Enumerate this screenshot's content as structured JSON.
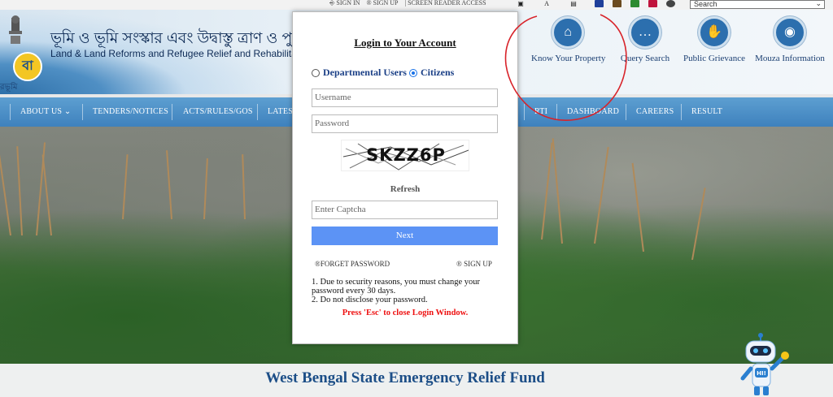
{
  "topbar": {
    "links": [
      "SIGN IN",
      "SIGN UP",
      "SCREEN READER ACCESS"
    ],
    "tool_icons": [
      "sitemap-icon",
      "font-size-icon",
      "text-icon"
    ],
    "theme_colors": [
      "#1f3f9a",
      "#6b4a1f",
      "#2e8b2e",
      "#c0143c",
      "#444444"
    ],
    "search_placeholder": "Search"
  },
  "header": {
    "beng_title": "ভূমি ও ভূমি সংস্কার এবং উদ্বাস্তু ত্রাণ ও পুনর্বাসন দ",
    "eng_title": "Land & Land Reforms and Refugee Relief and Rehabilitation Depar",
    "logo_caption": "রভূমি",
    "quick_links": [
      {
        "label": "Know Your Property",
        "icon": "home-icon"
      },
      {
        "label": "Query Search",
        "icon": "chat-icon"
      },
      {
        "label": "Public Grievance",
        "icon": "hand-icon"
      },
      {
        "label": "Mouza Information",
        "icon": "globe-icon"
      }
    ],
    "partial_label": "s"
  },
  "nav": {
    "items": [
      "ABOUT US",
      "TENDERS/NOTICES",
      "ACTS/RULES/GOS",
      "LATES",
      "RTI",
      "DASHBOARD",
      "CAREERS",
      "RESULT"
    ]
  },
  "login": {
    "title": "Login to Your Account",
    "radio_departmental": "Departmental Users",
    "radio_citizens": "Citizens",
    "username_placeholder": "Username",
    "password_placeholder": "Password",
    "captcha_text": "SKZZ6P",
    "refresh_label": "Refresh",
    "captcha_placeholder": "Enter Captcha",
    "next_label": "Next",
    "forget_password": "®FORGET PASSWORD",
    "sign_up": "® SIGN UP",
    "note_1": "1. Due to security reasons, you must change your password every 30 days.",
    "note_2": "2. Do not disclose your password.",
    "esc_note": "Press 'Esc' to close Login Window."
  },
  "footer": {
    "fund_title": "West Bengal State Emergency Relief Fund"
  },
  "chatbot": {
    "badge": "HI!"
  }
}
